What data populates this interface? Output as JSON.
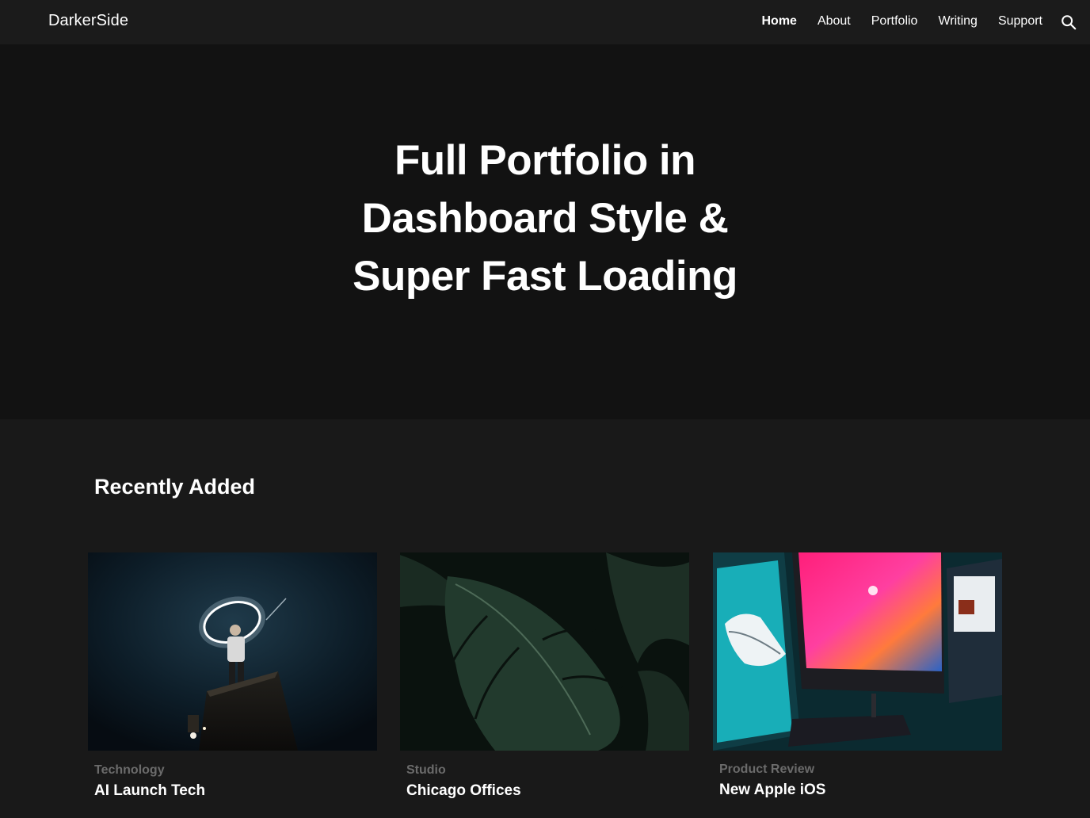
{
  "header": {
    "brand": "DarkerSide",
    "nav": [
      {
        "label": "Home",
        "active": true
      },
      {
        "label": "About",
        "active": false
      },
      {
        "label": "Portfolio",
        "active": false
      },
      {
        "label": "Writing",
        "active": false
      },
      {
        "label": "Support",
        "active": false
      }
    ],
    "search_icon": "search-icon"
  },
  "hero": {
    "title_line1": "Full Portfolio in",
    "title_line2": "Dashboard Style &",
    "title_line3": "Super Fast Loading"
  },
  "recent": {
    "title": "Recently Added",
    "cards": [
      {
        "category": "Technology",
        "title": "AI Launch Tech",
        "image_icon": "person-light-ring-image"
      },
      {
        "category": "Studio",
        "title": "Chicago Offices",
        "image_icon": "monstera-leaves-image"
      },
      {
        "category": "Product Review",
        "title": "New Apple iOS",
        "image_icon": "computer-monitors-image"
      }
    ]
  },
  "colors": {
    "header_bg": "#1b1b1b",
    "hero_bg": "#121212",
    "page_bg": "#191919",
    "category_text": "#6b6b6b"
  }
}
